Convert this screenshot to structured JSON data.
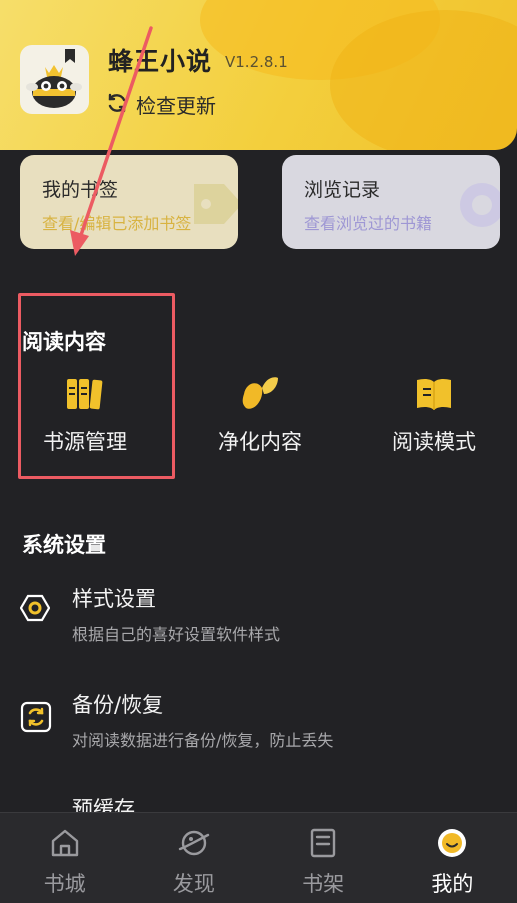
{
  "app": {
    "name": "蜂王小说",
    "version": "V1.2.8.1",
    "update_label": "检查更新"
  },
  "quick_cards": [
    {
      "title": "我的书签",
      "subtitle": "查看/编辑已添加书签"
    },
    {
      "title": "浏览记录",
      "subtitle": "查看浏览过的书籍"
    }
  ],
  "reading": {
    "title": "阅读内容",
    "items": [
      {
        "label": "书源管理",
        "icon": "books-icon"
      },
      {
        "label": "净化内容",
        "icon": "leaf-icon"
      },
      {
        "label": "阅读模式",
        "icon": "open-book-icon"
      }
    ]
  },
  "system": {
    "title": "系统设置",
    "items": [
      {
        "title": "样式设置",
        "desc": "根据自己的喜好设置软件样式",
        "icon": "hexagon-gear-icon"
      },
      {
        "title": "备份/恢复",
        "desc": "对阅读数据进行备份/恢复，防止丢失",
        "icon": "sync-icon"
      },
      {
        "title": "预缓存",
        "icon": "download-icon"
      }
    ]
  },
  "nav": {
    "items": [
      {
        "label": "书城",
        "icon": "home-icon"
      },
      {
        "label": "发现",
        "icon": "planet-icon"
      },
      {
        "label": "书架",
        "icon": "shelf-icon"
      },
      {
        "label": "我的",
        "icon": "avatar-icon"
      }
    ],
    "active": "我的"
  },
  "colors": {
    "accent": "#f3c73a",
    "background": "#222225",
    "annotation_red": "#ec5b62"
  }
}
